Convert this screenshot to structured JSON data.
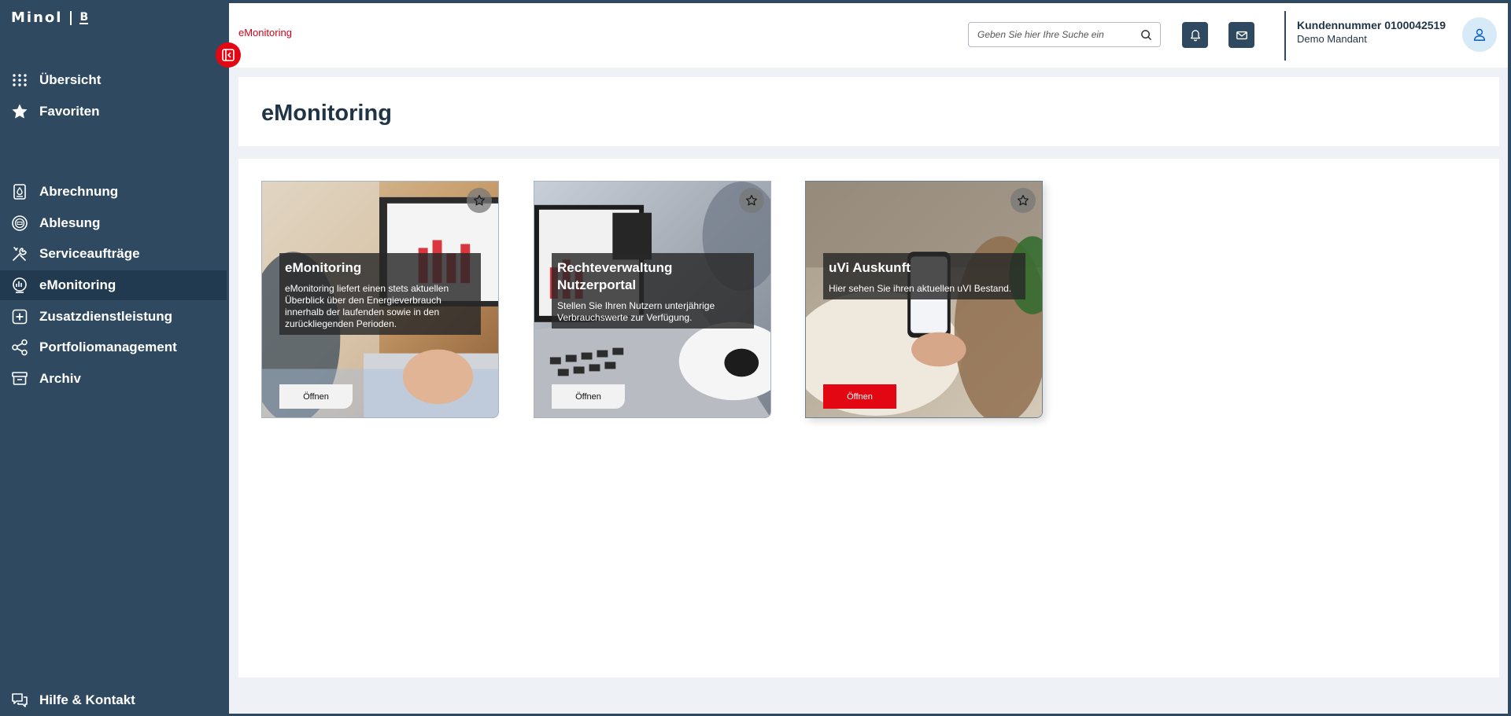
{
  "brand": {
    "logo_text": "Minol",
    "logo_mark": "B"
  },
  "sidebar": {
    "top_items": [
      {
        "label": "Übersicht",
        "icon": "grid-icon"
      },
      {
        "label": "Favoriten",
        "icon": "star-icon"
      }
    ],
    "items": [
      {
        "label": "Abrechnung",
        "icon": "billing-icon"
      },
      {
        "label": "Ablesung",
        "icon": "meter-icon"
      },
      {
        "label": "Serviceaufträge",
        "icon": "tools-icon"
      },
      {
        "label": "eMonitoring",
        "icon": "chart-monitor-icon",
        "active": true
      },
      {
        "label": "Zusatzdienstleistung",
        "icon": "plus-square-icon"
      },
      {
        "label": "Portfoliomanagement",
        "icon": "share-icon"
      },
      {
        "label": "Archiv",
        "icon": "archive-icon"
      }
    ],
    "footer": {
      "label": "Hilfe & Kontakt",
      "icon": "chat-icon"
    }
  },
  "header": {
    "breadcrumb": "eMonitoring",
    "search_placeholder": "Geben Sie hier Ihre Suche ein",
    "customer_number": "Kundennummer 0100042519",
    "mandant": "Demo Mandant"
  },
  "page": {
    "title": "eMonitoring"
  },
  "cards": [
    {
      "title": "eMonitoring",
      "description": "eMonitoring liefert einen stets aktuellen Überblick über den Energieverbrauch innerhalb der laufenden sowie in den zurückliegenden Perioden.",
      "button": "Öffnen"
    },
    {
      "title": "Rechteverwaltung Nutzerportal",
      "description": "Stellen Sie Ihren Nutzern unterjährige Verbrauchswerte zur Verfügung.",
      "button": "Öffnen"
    },
    {
      "title": "uVi Auskunft",
      "description": "Hier sehen Sie ihren aktuellen uVI Bestand.",
      "button": "Öffnen"
    }
  ],
  "colors": {
    "sidebar": "#2f4a60",
    "accent": "#e30613",
    "text_dark": "#1f3446"
  }
}
